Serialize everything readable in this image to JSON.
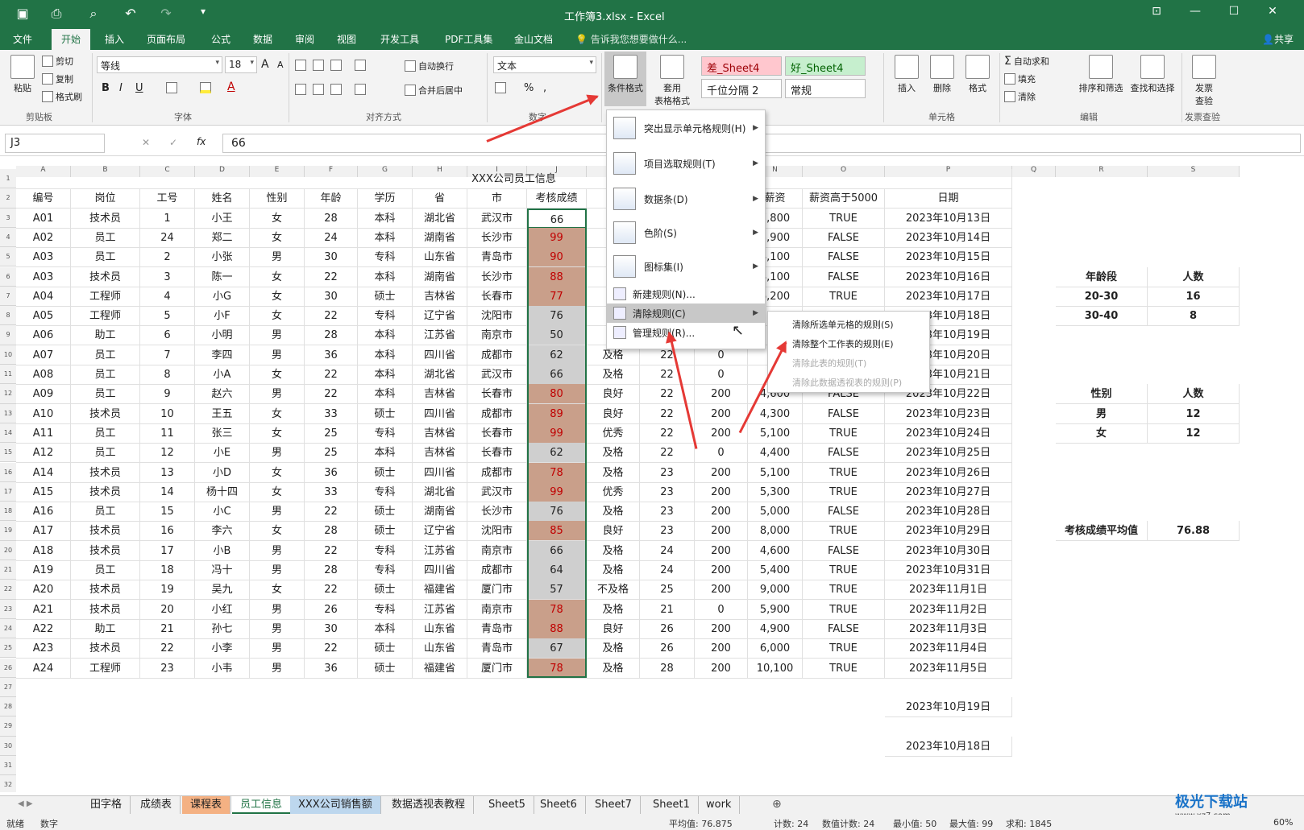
{
  "window": {
    "title": "工作簿3.xlsx - Excel",
    "share": "共享"
  },
  "quick_access": [
    "save-icon",
    "print-preview-icon",
    "preview-icon",
    "undo-icon",
    "redo-icon",
    "customize-icon"
  ],
  "ribbon_tabs": [
    "文件",
    "开始",
    "插入",
    "页面布局",
    "公式",
    "数据",
    "审阅",
    "视图",
    "开发工具",
    "PDF工具集",
    "金山文档"
  ],
  "active_tab": "开始",
  "tell_me": "告诉我您想要做什么...",
  "ribbon": {
    "clipboard": {
      "paste": "粘贴",
      "cut": "剪切",
      "copy": "复制",
      "format_painter": "格式刷",
      "group": "剪贴板"
    },
    "font": {
      "family": "等线",
      "size": "18",
      "bold": "B",
      "italic": "I",
      "underline": "U",
      "grow": "A",
      "shrink": "A",
      "group": "字体"
    },
    "alignment": {
      "wrap": "自动换行",
      "merge": "合并后居中",
      "group": "对齐方式"
    },
    "number": {
      "format": "文本",
      "percent": "%",
      "comma": ",",
      "group": "数字"
    },
    "styles": {
      "conditional": "条件格式",
      "table": "套用",
      "table2": "表格格式",
      "bad": "差_Sheet4",
      "good": "好_Sheet4",
      "thousands": "千位分隔 2",
      "normal": "常规"
    },
    "cells": {
      "insert": "插入",
      "delete": "删除",
      "format": "格式",
      "group": "单元格"
    },
    "editing": {
      "autosum": "自动求和",
      "fill": "填充",
      "clear": "清除",
      "sort": "排序和筛选",
      "find": "查找和选择",
      "group": "编辑"
    },
    "invoice": {
      "check": "发票",
      "check2": "查验",
      "group": "发票查验"
    }
  },
  "formula_bar": {
    "name_box": "J3",
    "fx": "fx",
    "value": "66"
  },
  "columns": [
    "A",
    "B",
    "C",
    "D",
    "E",
    "F",
    "G",
    "H",
    "I",
    "J",
    "K",
    "L",
    "M",
    "N",
    "O",
    "P",
    "Q",
    "R",
    "S"
  ],
  "sheet": {
    "title": "XXX公司员工信息",
    "headers": [
      "编号",
      "岗位",
      "工号",
      "姓名",
      "性别",
      "年龄",
      "学历",
      "省",
      "市",
      "考核成绩",
      "",
      "",
      "",
      "薪资",
      "薪资高于5000",
      "日期"
    ],
    "rows": [
      [
        "A01",
        "技术员",
        "1",
        "小王",
        "女",
        "28",
        "本科",
        "湖北省",
        "武汉市",
        "66",
        "",
        "",
        "",
        "7,800",
        "TRUE",
        "2023年10月13日"
      ],
      [
        "A02",
        "员工",
        "24",
        "郑二",
        "女",
        "24",
        "本科",
        "湖南省",
        "长沙市",
        "99",
        "",
        "",
        "",
        "3,900",
        "FALSE",
        "2023年10月14日"
      ],
      [
        "A03",
        "员工",
        "2",
        "小张",
        "男",
        "30",
        "专科",
        "山东省",
        "青岛市",
        "90",
        "",
        "",
        "",
        "4,100",
        "FALSE",
        "2023年10月15日"
      ],
      [
        "A03",
        "技术员",
        "3",
        "陈一",
        "女",
        "22",
        "本科",
        "湖南省",
        "长沙市",
        "88",
        "",
        "",
        "",
        "4,100",
        "FALSE",
        "2023年10月16日"
      ],
      [
        "A04",
        "工程师",
        "4",
        "小G",
        "女",
        "30",
        "硕士",
        "吉林省",
        "长春市",
        "77",
        "",
        "",
        "",
        "6,200",
        "TRUE",
        "2023年10月17日"
      ],
      [
        "A05",
        "工程师",
        "5",
        "小F",
        "女",
        "22",
        "专科",
        "辽宁省",
        "沈阳市",
        "76",
        "",
        "",
        "",
        "",
        "",
        "2023年10月18日"
      ],
      [
        "A06",
        "助工",
        "6",
        "小明",
        "男",
        "28",
        "本科",
        "江苏省",
        "南京市",
        "50",
        "",
        "",
        "",
        "",
        "",
        "2023年10月19日"
      ],
      [
        "A07",
        "员工",
        "7",
        "李四",
        "男",
        "36",
        "本科",
        "四川省",
        "成都市",
        "62",
        "及格",
        "22",
        "0",
        "",
        "",
        "2023年10月20日"
      ],
      [
        "A08",
        "员工",
        "8",
        "小A",
        "女",
        "22",
        "本科",
        "湖北省",
        "武汉市",
        "66",
        "及格",
        "22",
        "0",
        "",
        "",
        "2023年10月21日"
      ],
      [
        "A09",
        "员工",
        "9",
        "赵六",
        "男",
        "22",
        "本科",
        "吉林省",
        "长春市",
        "80",
        "良好",
        "22",
        "200",
        "4,600",
        "FALSE",
        "2023年10月22日"
      ],
      [
        "A10",
        "技术员",
        "10",
        "王五",
        "女",
        "33",
        "硕士",
        "四川省",
        "成都市",
        "89",
        "良好",
        "22",
        "200",
        "4,300",
        "FALSE",
        "2023年10月23日"
      ],
      [
        "A11",
        "员工",
        "11",
        "张三",
        "女",
        "25",
        "专科",
        "吉林省",
        "长春市",
        "99",
        "优秀",
        "22",
        "200",
        "5,100",
        "TRUE",
        "2023年10月24日"
      ],
      [
        "A12",
        "员工",
        "12",
        "小E",
        "男",
        "25",
        "本科",
        "吉林省",
        "长春市",
        "62",
        "及格",
        "22",
        "0",
        "4,400",
        "FALSE",
        "2023年10月25日"
      ],
      [
        "A14",
        "技术员",
        "13",
        "小D",
        "女",
        "36",
        "硕士",
        "四川省",
        "成都市",
        "78",
        "及格",
        "23",
        "200",
        "5,100",
        "TRUE",
        "2023年10月26日"
      ],
      [
        "A15",
        "技术员",
        "14",
        "杨十四",
        "女",
        "33",
        "专科",
        "湖北省",
        "武汉市",
        "99",
        "优秀",
        "23",
        "200",
        "5,300",
        "TRUE",
        "2023年10月27日"
      ],
      [
        "A16",
        "员工",
        "15",
        "小C",
        "男",
        "22",
        "硕士",
        "湖南省",
        "长沙市",
        "76",
        "及格",
        "23",
        "200",
        "5,000",
        "FALSE",
        "2023年10月28日"
      ],
      [
        "A17",
        "技术员",
        "16",
        "李六",
        "女",
        "28",
        "硕士",
        "辽宁省",
        "沈阳市",
        "85",
        "良好",
        "23",
        "200",
        "8,000",
        "TRUE",
        "2023年10月29日"
      ],
      [
        "A18",
        "技术员",
        "17",
        "小B",
        "男",
        "22",
        "专科",
        "江苏省",
        "南京市",
        "66",
        "及格",
        "24",
        "200",
        "4,600",
        "FALSE",
        "2023年10月30日"
      ],
      [
        "A19",
        "员工",
        "18",
        "冯十",
        "男",
        "28",
        "专科",
        "四川省",
        "成都市",
        "64",
        "及格",
        "24",
        "200",
        "5,400",
        "TRUE",
        "2023年10月31日"
      ],
      [
        "A20",
        "技术员",
        "19",
        "吴九",
        "女",
        "22",
        "硕士",
        "福建省",
        "厦门市",
        "57",
        "不及格",
        "25",
        "200",
        "9,000",
        "TRUE",
        "2023年11月1日"
      ],
      [
        "A21",
        "技术员",
        "20",
        "小红",
        "男",
        "26",
        "专科",
        "江苏省",
        "南京市",
        "78",
        "及格",
        "21",
        "0",
        "5,900",
        "TRUE",
        "2023年11月2日"
      ],
      [
        "A22",
        "助工",
        "21",
        "孙七",
        "男",
        "30",
        "本科",
        "山东省",
        "青岛市",
        "88",
        "良好",
        "26",
        "200",
        "4,900",
        "FALSE",
        "2023年11月3日"
      ],
      [
        "A23",
        "技术员",
        "22",
        "小李",
        "男",
        "22",
        "硕士",
        "山东省",
        "青岛市",
        "67",
        "及格",
        "26",
        "200",
        "6,000",
        "TRUE",
        "2023年11月4日"
      ],
      [
        "A24",
        "工程师",
        "23",
        "小韦",
        "男",
        "36",
        "硕士",
        "福建省",
        "厦门市",
        "78",
        "及格",
        "28",
        "200",
        "10,100",
        "TRUE",
        "2023年11月5日"
      ]
    ],
    "extra_dates": [
      "2023年10月19日",
      "2023年10月18日"
    ],
    "side": {
      "age_header": [
        "年龄段",
        "人数"
      ],
      "age_rows": [
        [
          "20-30",
          "16"
        ],
        [
          "30-40",
          "8"
        ]
      ],
      "gender_header": [
        "性别",
        "人数"
      ],
      "gender_rows": [
        [
          "男",
          "12"
        ],
        [
          "女",
          "12"
        ]
      ],
      "avg_label": "考核成绩平均值",
      "avg_value": "76.88"
    }
  },
  "cf_menu": {
    "items": [
      {
        "label": "突出显示单元格规则(H)",
        "icon": "highlight-rules-icon"
      },
      {
        "label": "项目选取规则(T)",
        "icon": "top-bottom-rules-icon"
      },
      {
        "label": "数据条(D)",
        "icon": "data-bars-icon"
      },
      {
        "label": "色阶(S)",
        "icon": "color-scales-icon"
      },
      {
        "label": "图标集(I)",
        "icon": "icon-sets-icon"
      }
    ],
    "new_rule": "新建规则(N)...",
    "clear_rules": "清除规则(C)",
    "manage_rules": "管理规则(R)..."
  },
  "clear_submenu": [
    "清除所选单元格的规则(S)",
    "清除整个工作表的规则(E)",
    "清除此表的规则(T)",
    "清除此数据透视表的规则(P)"
  ],
  "sheet_tabs": [
    "田字格",
    "成绩表",
    "课程表",
    "员工信息",
    "XXX公司销售额",
    "数据透视表教程",
    "Sheet5",
    "Sheet6",
    "Sheet7",
    "Sheet1",
    "work"
  ],
  "active_sheet": "员工信息",
  "status": {
    "ready": "就绪",
    "mode": "数字",
    "average": "平均值: 76.875",
    "count": "计数: 24",
    "numcount": "数值计数: 24",
    "min": "最小值: 50",
    "max": "最大值: 99",
    "sum": "求和: 1845",
    "zoom": "60%"
  },
  "watermark": "极光下载站",
  "watermark_url": "www.xz7.com",
  "colors": {
    "excel_green": "#217346",
    "high_fill": "#c99f8a",
    "high_text": "#c00000",
    "low_fill": "#cfcfcf",
    "arrow": "#e53935",
    "bad_fill": "#ffc7ce",
    "good_fill": "#c6efce"
  }
}
